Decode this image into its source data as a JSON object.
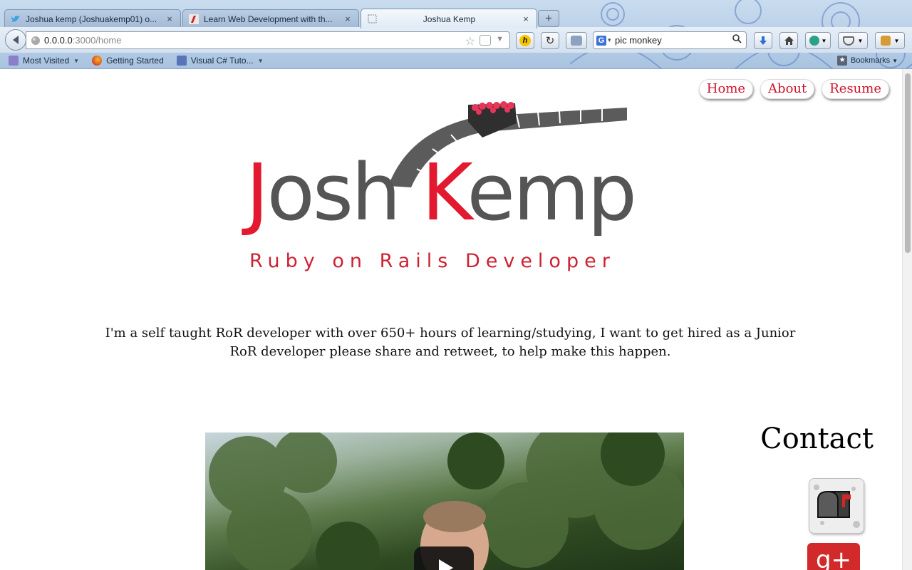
{
  "browser": {
    "tabs": [
      {
        "title": "Joshua kemp (Joshuakemp01) o...",
        "favicon": "twitter-bird-icon",
        "active": false
      },
      {
        "title": "Learn Web Development with th...",
        "favicon": "codeschool-icon",
        "active": false
      },
      {
        "title": "Joshua Kemp",
        "favicon": "blank-page-icon",
        "active": true
      }
    ],
    "new_tab": "+",
    "close_glyph": "×",
    "url": {
      "host": "0.0.0.0",
      "path": ":3000/home"
    },
    "search": {
      "query": "pic monkey",
      "engine": "G"
    },
    "bookmarks_toolbar": [
      {
        "label": "Most Visited",
        "has_arrow": true
      },
      {
        "label": "Getting Started",
        "has_arrow": false
      },
      {
        "label": "Visual C# Tuto...",
        "has_arrow": true
      }
    ],
    "bookmarks_menu": "Bookmarks"
  },
  "site": {
    "nav": [
      "Home",
      "About",
      "Resume"
    ],
    "logo": {
      "first_j": "J",
      "first_rest": "osh",
      "second_k": "K",
      "second_rest": "emp",
      "tagline": "Ruby on Rails Developer"
    },
    "intro": "I'm a self taught RoR developer with over 650+ hours of learning/studying, I want to get hired as a Junior RoR developer please share and retweet, to help make this happen.",
    "contact_heading": "Contact",
    "gplus_label": "g+"
  },
  "colors": {
    "accent": "#d0112b",
    "logo_red": "#e2192f",
    "logo_gray": "#555555"
  }
}
